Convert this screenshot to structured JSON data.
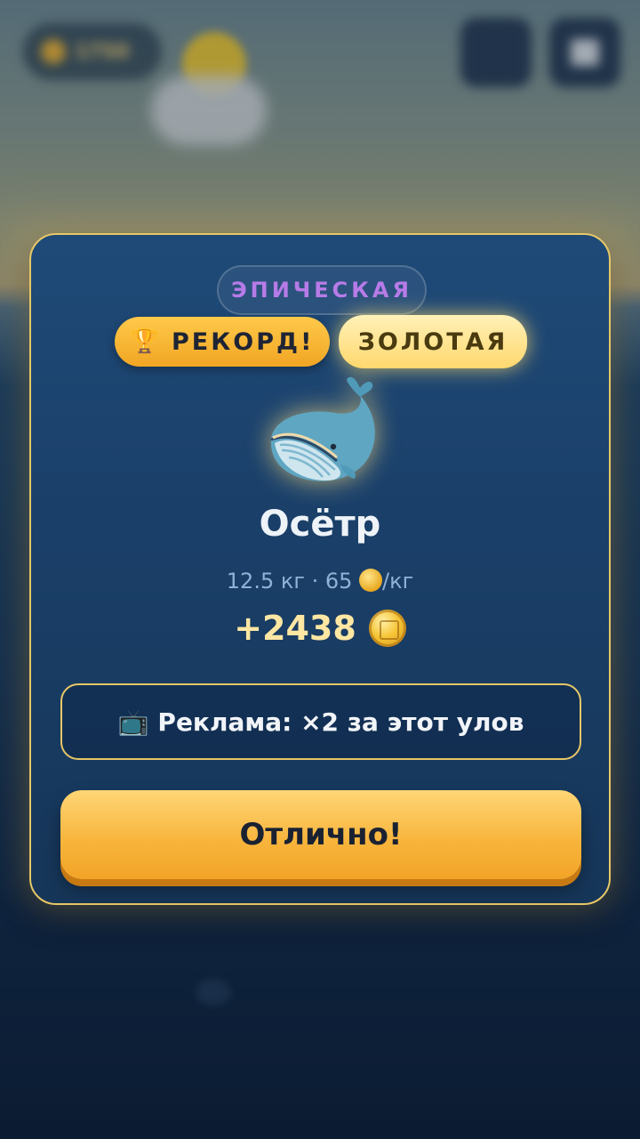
{
  "hud": {
    "coins_label": "1750"
  },
  "modal": {
    "rarity_label": "ЭПИЧЕСКАЯ",
    "record_label": "РЕКОРД!",
    "record_icon": "🏆",
    "golden_label": "ЗОЛОТАЯ",
    "fish_icon": "whale-icon",
    "fish_name": "Осётр",
    "stats_weight": "12.5 кг · 65 ",
    "stats_unit": "/кг",
    "reward_value": "+2438",
    "ad_icon": "📺",
    "ad_label": "Реклама: ×2 за этот улов",
    "confirm_label": "Отлично!"
  },
  "colors": {
    "accent_gold": "#e7c766",
    "rarity_epic": "#b77be8",
    "panel_blue": "#1f4a78",
    "button_orange": "#f7b33a"
  }
}
